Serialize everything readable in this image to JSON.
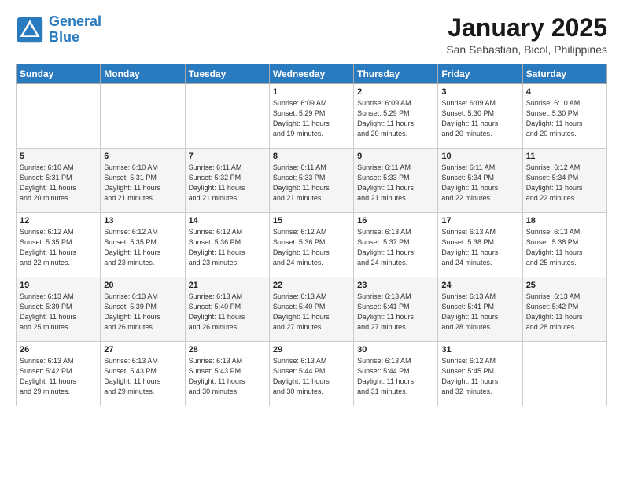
{
  "header": {
    "logo_line1": "General",
    "logo_line2": "Blue",
    "month": "January 2025",
    "location": "San Sebastian, Bicol, Philippines"
  },
  "days_of_week": [
    "Sunday",
    "Monday",
    "Tuesday",
    "Wednesday",
    "Thursday",
    "Friday",
    "Saturday"
  ],
  "weeks": [
    [
      {
        "day": "",
        "info": ""
      },
      {
        "day": "",
        "info": ""
      },
      {
        "day": "",
        "info": ""
      },
      {
        "day": "1",
        "info": "Sunrise: 6:09 AM\nSunset: 5:29 PM\nDaylight: 11 hours\nand 19 minutes."
      },
      {
        "day": "2",
        "info": "Sunrise: 6:09 AM\nSunset: 5:29 PM\nDaylight: 11 hours\nand 20 minutes."
      },
      {
        "day": "3",
        "info": "Sunrise: 6:09 AM\nSunset: 5:30 PM\nDaylight: 11 hours\nand 20 minutes."
      },
      {
        "day": "4",
        "info": "Sunrise: 6:10 AM\nSunset: 5:30 PM\nDaylight: 11 hours\nand 20 minutes."
      }
    ],
    [
      {
        "day": "5",
        "info": "Sunrise: 6:10 AM\nSunset: 5:31 PM\nDaylight: 11 hours\nand 20 minutes."
      },
      {
        "day": "6",
        "info": "Sunrise: 6:10 AM\nSunset: 5:31 PM\nDaylight: 11 hours\nand 21 minutes."
      },
      {
        "day": "7",
        "info": "Sunrise: 6:11 AM\nSunset: 5:32 PM\nDaylight: 11 hours\nand 21 minutes."
      },
      {
        "day": "8",
        "info": "Sunrise: 6:11 AM\nSunset: 5:33 PM\nDaylight: 11 hours\nand 21 minutes."
      },
      {
        "day": "9",
        "info": "Sunrise: 6:11 AM\nSunset: 5:33 PM\nDaylight: 11 hours\nand 21 minutes."
      },
      {
        "day": "10",
        "info": "Sunrise: 6:11 AM\nSunset: 5:34 PM\nDaylight: 11 hours\nand 22 minutes."
      },
      {
        "day": "11",
        "info": "Sunrise: 6:12 AM\nSunset: 5:34 PM\nDaylight: 11 hours\nand 22 minutes."
      }
    ],
    [
      {
        "day": "12",
        "info": "Sunrise: 6:12 AM\nSunset: 5:35 PM\nDaylight: 11 hours\nand 22 minutes."
      },
      {
        "day": "13",
        "info": "Sunrise: 6:12 AM\nSunset: 5:35 PM\nDaylight: 11 hours\nand 23 minutes."
      },
      {
        "day": "14",
        "info": "Sunrise: 6:12 AM\nSunset: 5:36 PM\nDaylight: 11 hours\nand 23 minutes."
      },
      {
        "day": "15",
        "info": "Sunrise: 6:12 AM\nSunset: 5:36 PM\nDaylight: 11 hours\nand 24 minutes."
      },
      {
        "day": "16",
        "info": "Sunrise: 6:13 AM\nSunset: 5:37 PM\nDaylight: 11 hours\nand 24 minutes."
      },
      {
        "day": "17",
        "info": "Sunrise: 6:13 AM\nSunset: 5:38 PM\nDaylight: 11 hours\nand 24 minutes."
      },
      {
        "day": "18",
        "info": "Sunrise: 6:13 AM\nSunset: 5:38 PM\nDaylight: 11 hours\nand 25 minutes."
      }
    ],
    [
      {
        "day": "19",
        "info": "Sunrise: 6:13 AM\nSunset: 5:39 PM\nDaylight: 11 hours\nand 25 minutes."
      },
      {
        "day": "20",
        "info": "Sunrise: 6:13 AM\nSunset: 5:39 PM\nDaylight: 11 hours\nand 26 minutes."
      },
      {
        "day": "21",
        "info": "Sunrise: 6:13 AM\nSunset: 5:40 PM\nDaylight: 11 hours\nand 26 minutes."
      },
      {
        "day": "22",
        "info": "Sunrise: 6:13 AM\nSunset: 5:40 PM\nDaylight: 11 hours\nand 27 minutes."
      },
      {
        "day": "23",
        "info": "Sunrise: 6:13 AM\nSunset: 5:41 PM\nDaylight: 11 hours\nand 27 minutes."
      },
      {
        "day": "24",
        "info": "Sunrise: 6:13 AM\nSunset: 5:41 PM\nDaylight: 11 hours\nand 28 minutes."
      },
      {
        "day": "25",
        "info": "Sunrise: 6:13 AM\nSunset: 5:42 PM\nDaylight: 11 hours\nand 28 minutes."
      }
    ],
    [
      {
        "day": "26",
        "info": "Sunrise: 6:13 AM\nSunset: 5:42 PM\nDaylight: 11 hours\nand 29 minutes."
      },
      {
        "day": "27",
        "info": "Sunrise: 6:13 AM\nSunset: 5:43 PM\nDaylight: 11 hours\nand 29 minutes."
      },
      {
        "day": "28",
        "info": "Sunrise: 6:13 AM\nSunset: 5:43 PM\nDaylight: 11 hours\nand 30 minutes."
      },
      {
        "day": "29",
        "info": "Sunrise: 6:13 AM\nSunset: 5:44 PM\nDaylight: 11 hours\nand 30 minutes."
      },
      {
        "day": "30",
        "info": "Sunrise: 6:13 AM\nSunset: 5:44 PM\nDaylight: 11 hours\nand 31 minutes."
      },
      {
        "day": "31",
        "info": "Sunrise: 6:12 AM\nSunset: 5:45 PM\nDaylight: 11 hours\nand 32 minutes."
      },
      {
        "day": "",
        "info": ""
      }
    ]
  ]
}
